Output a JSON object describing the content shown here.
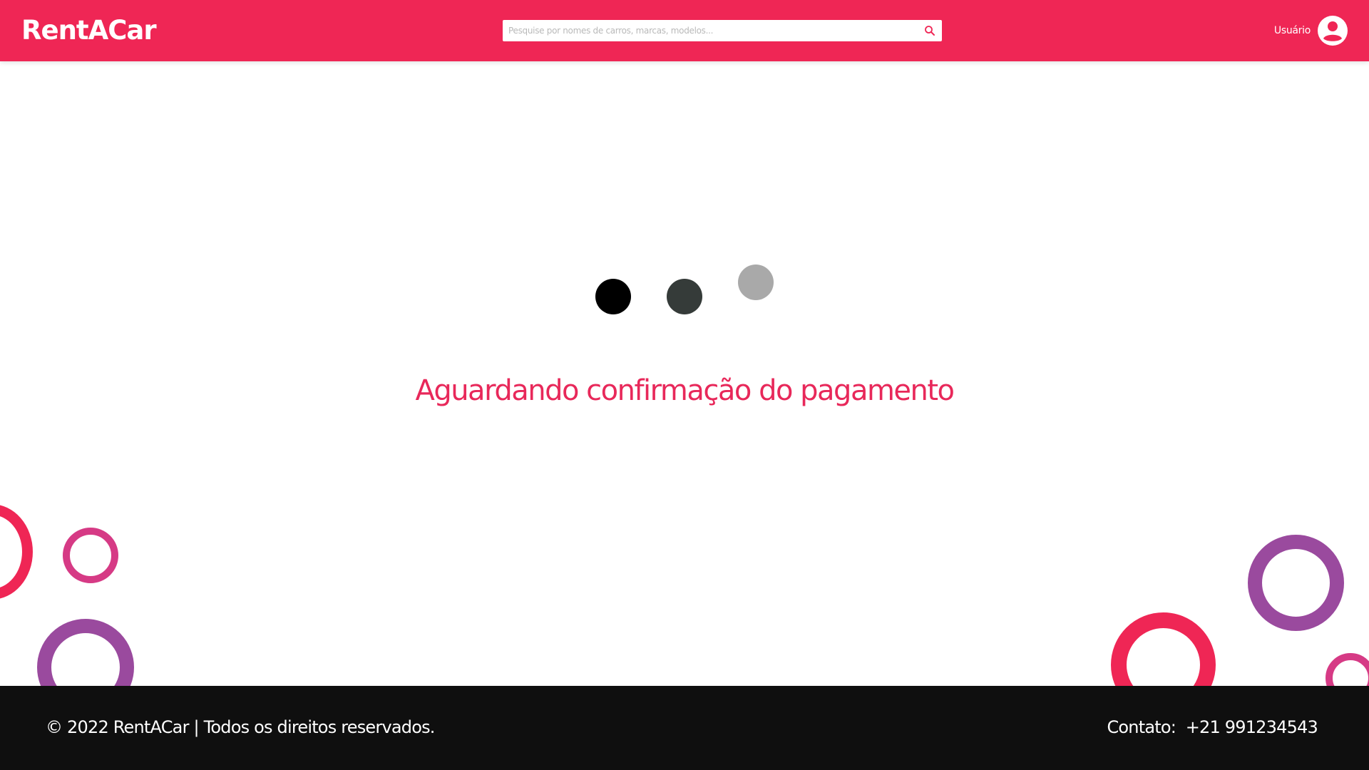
{
  "header": {
    "logo": "RentACar",
    "search_placeholder": "Pesquise por nomes de carros, marcas, modelos...",
    "search_icon": "search-icon",
    "user_label": "Usuário",
    "user_icon": "account-circle-icon"
  },
  "main": {
    "message": "Aguardando confirmação do pagamento",
    "loader_dots": [
      "#000000",
      "#353b39",
      "#a9a9a9"
    ]
  },
  "footer": {
    "copyright": "© 2022 RentACar | Todos os direitos reservados.",
    "contact_label": "Contato:",
    "contact_phone": "+21 991234543"
  },
  "colors": {
    "brand": "#ef2655",
    "ring_red": "#ef2655",
    "ring_magenta": "#d63a85",
    "ring_purple": "#9a4a9e",
    "footer_bg": "#0f0f0f"
  }
}
